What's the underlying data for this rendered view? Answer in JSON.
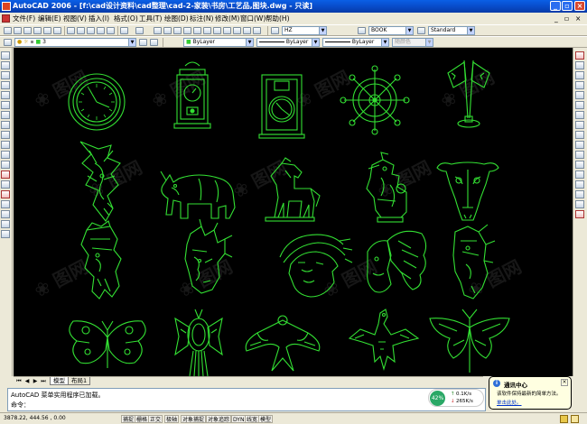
{
  "window": {
    "title": "AutoCAD 2006 - [f:\\cad设计资料\\cad整理\\cad-2-家装\\书房\\工艺品,图块.dwg - 只读]",
    "controls": [
      "_",
      "▫",
      "×"
    ]
  },
  "menu": {
    "items": [
      "文件(F)",
      "编辑(E)",
      "视图(V)",
      "插入(I)",
      "格式(O)",
      "工具(T)",
      "绘图(D)",
      "标注(N)",
      "修改(M)",
      "窗口(W)",
      "帮助(H)"
    ],
    "doc_controls": [
      "_",
      "▫",
      "×"
    ]
  },
  "toolbar": {
    "textstyle": "HZ",
    "dimstyle": "BOOK",
    "tablestyle": "Standard",
    "layer": "3",
    "color": "ByLayer",
    "linetype": "ByLayer",
    "lineweight": "ByLayer",
    "plotstyle": "随颜色"
  },
  "tabs": [
    "模型",
    "布局1"
  ],
  "command": {
    "history": "AutoCAD 菜单实用程序已加载。",
    "prompt": "命令："
  },
  "network_meter": {
    "percent": "42%",
    "up": "0.1K/s",
    "down": "265K/s"
  },
  "balloon": {
    "title": "通讯中心",
    "body": "该软件保持最新的简单方法。",
    "link": "单击此处。"
  },
  "status": {
    "coords": "3878.22, 444.56 , 0.00",
    "buttons": [
      "捕捉",
      "栅格",
      "正交",
      "极轴",
      "对象捕捉",
      "对象追踪",
      "DYN",
      "线宽",
      "模型"
    ]
  },
  "colors": {
    "cad_green": "#33e033",
    "canvas": "#000000",
    "title_blue": "#0848c4"
  },
  "icons": {
    "left_toolbar": [
      "line-icon",
      "construction-line-icon",
      "polyline-icon",
      "polygon-icon",
      "rectangle-icon",
      "arc-icon",
      "circle-icon",
      "revision-cloud-icon",
      "spline-icon",
      "ellipse-icon",
      "ellipse-arc-icon",
      "insert-block-icon",
      "make-block-icon",
      "point-icon",
      "hatch-icon",
      "gradient-icon",
      "region-icon",
      "table-icon",
      "mtext-icon"
    ],
    "right_toolbar": [
      "erase-icon",
      "copy-icon",
      "mirror-icon",
      "offset-icon",
      "array-icon",
      "move-icon",
      "rotate-icon",
      "scale-icon",
      "stretch-icon",
      "trim-icon",
      "extend-icon",
      "break-point-icon",
      "break-icon",
      "join-icon",
      "chamfer-icon",
      "fillet-icon",
      "explode-icon"
    ]
  }
}
